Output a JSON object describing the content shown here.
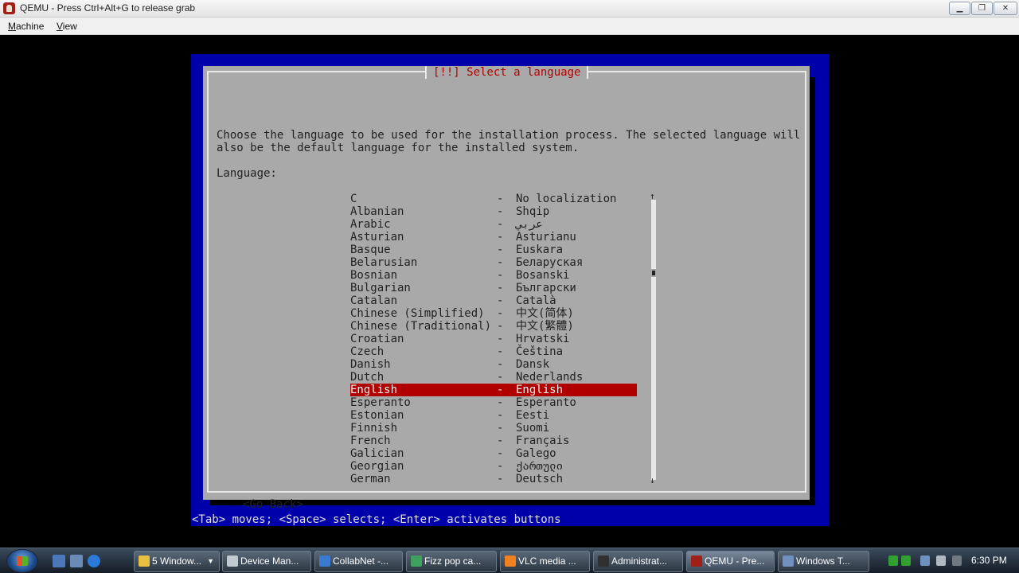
{
  "window": {
    "title": "QEMU - Press Ctrl+Alt+G to release grab",
    "minimize": "▁",
    "maximize": "❐",
    "close": "✕"
  },
  "menu": {
    "machine_first": "M",
    "machine_rest": "achine",
    "view_first": "V",
    "view_rest": "iew"
  },
  "dialog": {
    "title": "[!!] Select a language",
    "description_line1": "Choose the language to be used for the installation process. The selected language will",
    "description_line2": "also be the default language for the installed system.",
    "language_label": "Language:",
    "dash": "-",
    "languages": [
      {
        "name": "C",
        "native": "No localization"
      },
      {
        "name": "Albanian",
        "native": "Shqip"
      },
      {
        "name": "Arabic",
        "native": "عربي"
      },
      {
        "name": "Asturian",
        "native": "Asturianu"
      },
      {
        "name": "Basque",
        "native": "Euskara"
      },
      {
        "name": "Belarusian",
        "native": "Беларуская"
      },
      {
        "name": "Bosnian",
        "native": "Bosanski"
      },
      {
        "name": "Bulgarian",
        "native": "Български"
      },
      {
        "name": "Catalan",
        "native": "Català"
      },
      {
        "name": "Chinese (Simplified)",
        "native": "中文(简体)"
      },
      {
        "name": "Chinese (Traditional)",
        "native": "中文(繁體)"
      },
      {
        "name": "Croatian",
        "native": "Hrvatski"
      },
      {
        "name": "Czech",
        "native": "Čeština"
      },
      {
        "name": "Danish",
        "native": "Dansk"
      },
      {
        "name": "Dutch",
        "native": "Nederlands"
      },
      {
        "name": "English",
        "native": "English"
      },
      {
        "name": "Esperanto",
        "native": "Esperanto"
      },
      {
        "name": "Estonian",
        "native": "Eesti"
      },
      {
        "name": "Finnish",
        "native": "Suomi"
      },
      {
        "name": "French",
        "native": "Français"
      },
      {
        "name": "Galician",
        "native": "Galego"
      },
      {
        "name": "Georgian",
        "native": "ქართული"
      },
      {
        "name": "German",
        "native": "Deutsch"
      }
    ],
    "selected": "English",
    "scroll_up": "↑",
    "scroll_down": "↓",
    "go_back": "<Go Back>"
  },
  "hint": "<Tab> moves; <Space> selects; <Enter> activates buttons",
  "taskbar": {
    "tasks": [
      {
        "label": "5 Window...",
        "color": "#e8c040",
        "has_arrow": true
      },
      {
        "label": "Device Man...",
        "color": "#c0c8d0"
      },
      {
        "label": "CollabNet -...",
        "color": "#3a7ad0"
      },
      {
        "label": "Fizz pop ca...",
        "color": "#40a060"
      },
      {
        "label": "VLC media ...",
        "color": "#f08020"
      },
      {
        "label": "Administrat...",
        "color": "#303030"
      },
      {
        "label": "QEMU - Pre...",
        "color": "#a02018"
      },
      {
        "label": "Windows T...",
        "color": "#7090c0"
      }
    ],
    "clock": "6:30 PM"
  }
}
